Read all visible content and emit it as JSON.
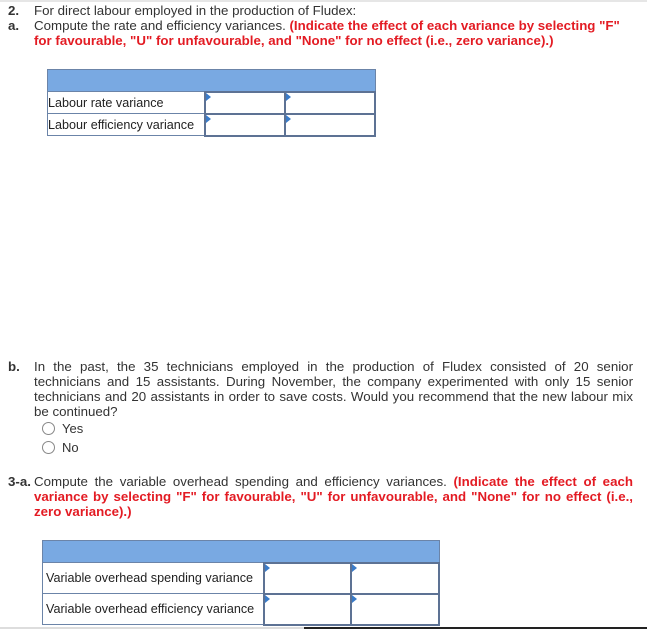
{
  "q2": {
    "number": "2.",
    "text": "For direct labour employed in the production of Fludex:"
  },
  "q2a": {
    "number": "a.",
    "text": "Compute the rate and efficiency variances. ",
    "instruction": "(Indicate the effect of each variance by selecting \"F\" for favourable, \"U\" for unfavourable, and \"None\" for no effect (i.e., zero variance).)",
    "table": {
      "rows": [
        {
          "label": "Labour rate variance",
          "amount": "",
          "effect": ""
        },
        {
          "label": "Labour efficiency variance",
          "amount": "",
          "effect": ""
        }
      ]
    }
  },
  "q2b": {
    "number": "b.",
    "text": "In the past, the 35 technicians employed in the production of Fludex consisted of 20 senior technicians and 15 assistants. During November, the company experimented with only 15 senior technicians and 20 assistants in order to save costs. Would you recommend that the new labour mix be continued?",
    "options": [
      "Yes",
      "No"
    ]
  },
  "q3a": {
    "number": "3-a.",
    "text": "Compute the variable overhead spending and efficiency variances. ",
    "instruction": "(Indicate the effect of each variance by selecting \"F\" for favourable, \"U\" for unfavourable, and \"None\" for no effect (i.e., zero variance).)",
    "table": {
      "rows": [
        {
          "label": "Variable overhead spending variance",
          "amount": "",
          "effect": ""
        },
        {
          "label": "Variable overhead efficiency variance",
          "amount": "",
          "effect": ""
        }
      ]
    }
  },
  "colors": {
    "instruction_red": "#e31b23",
    "table_header_blue": "#79a9e2",
    "input_border": "#5d7294"
  }
}
